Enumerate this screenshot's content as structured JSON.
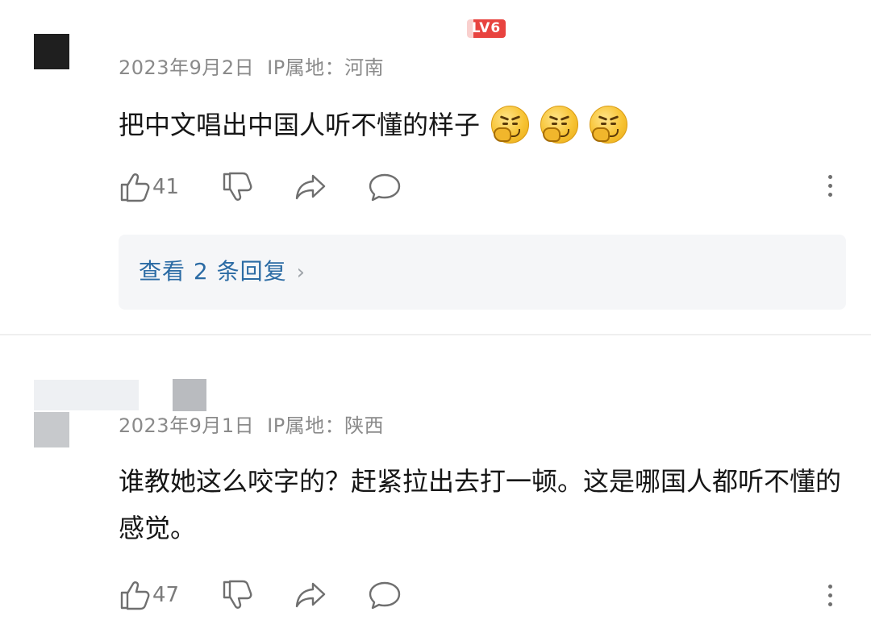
{
  "comments": [
    {
      "level_badge": "LV6",
      "date": "2023年9月2日",
      "ip": "IP属地：河南",
      "text": "把中文唱出中国人听不懂的样子",
      "emoji_name": "covering-mouth-laughing-emoji",
      "emoji_count": 3,
      "likes": "41",
      "replies_label": "查看 2 条回复"
    },
    {
      "date": "2023年9月1日",
      "ip": "IP属地：陕西",
      "text": "谁教她这么咬字的？赶紧拉出去打一顿。这是哪国人都听不懂的感觉。",
      "likes": "47"
    }
  ],
  "colors": {
    "meta_gray": "#8a8a8a",
    "link_blue": "#2b6ba4",
    "level_red": "#e8433f",
    "reply_bg": "#f5f6f8"
  }
}
